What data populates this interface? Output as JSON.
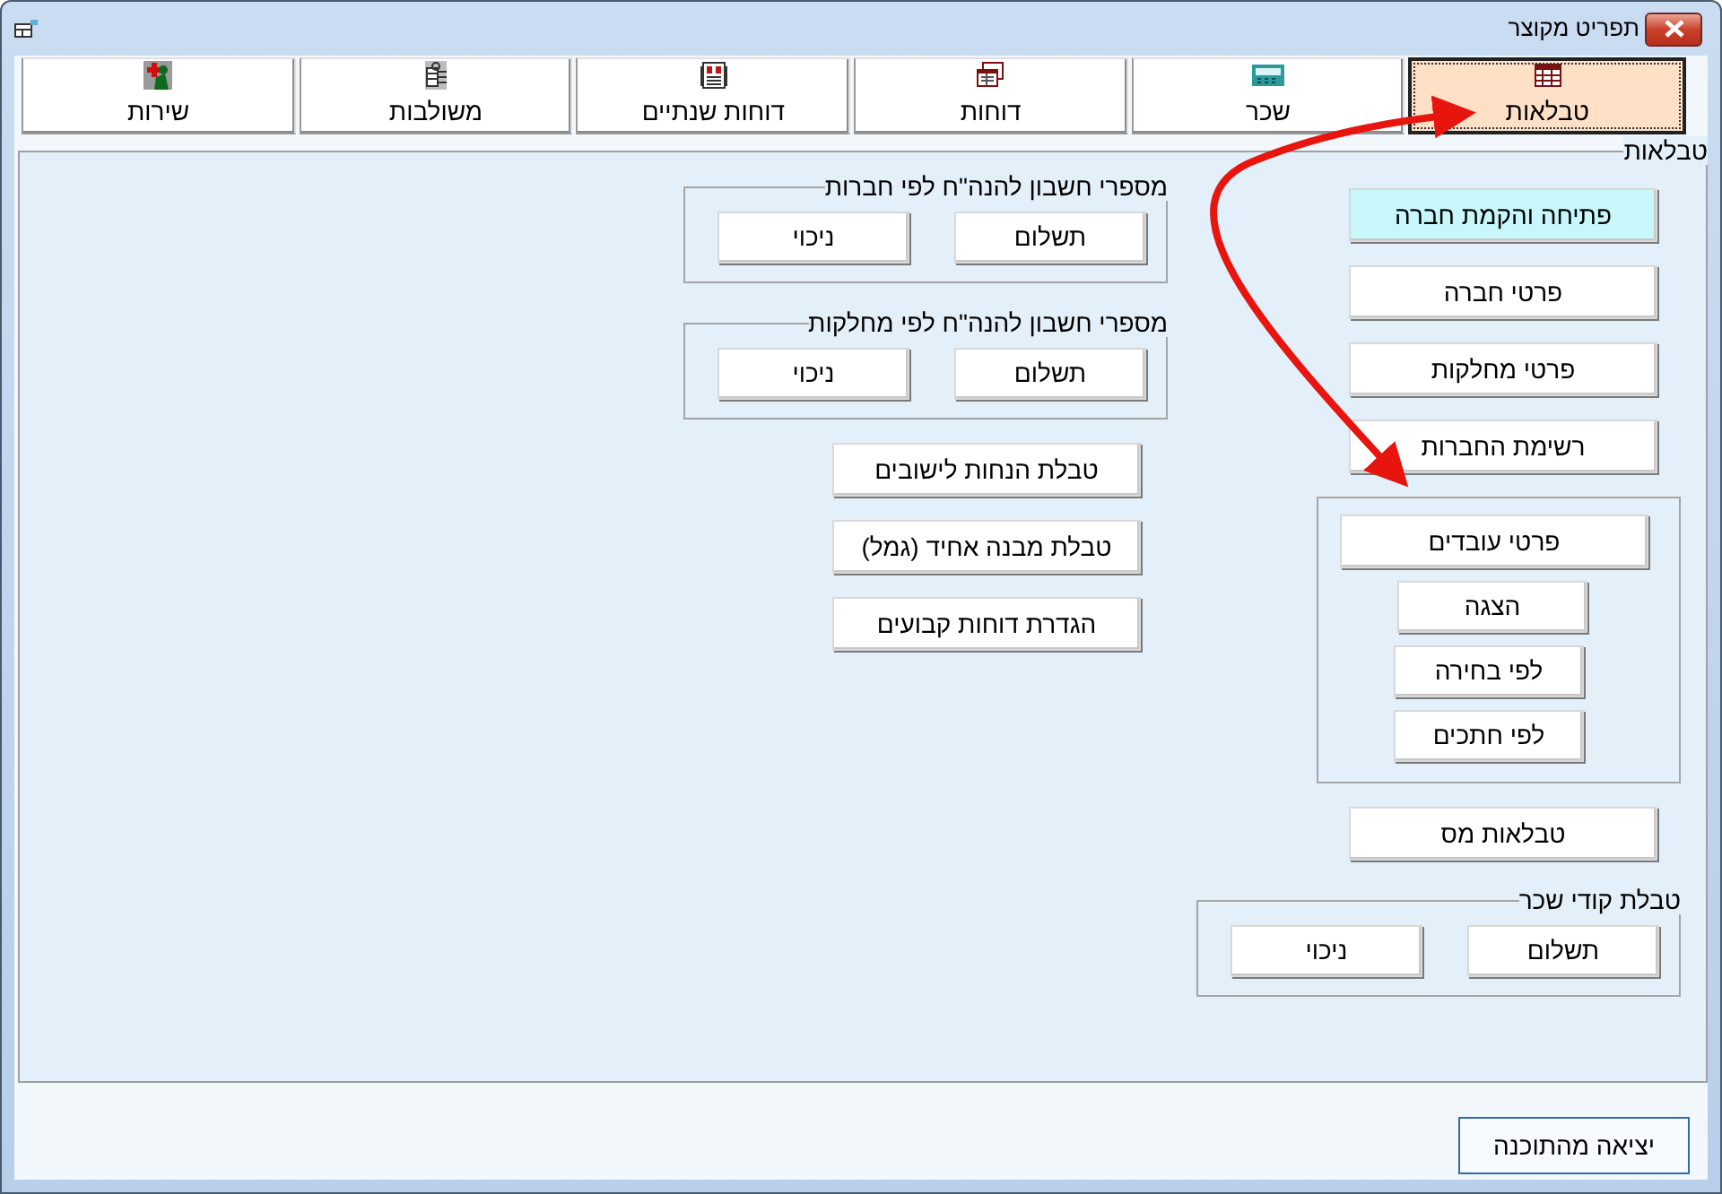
{
  "window": {
    "title": "תפריט מקוצר"
  },
  "tabs": [
    {
      "label": "טבלאות",
      "selected": true
    },
    {
      "label": "שכר",
      "selected": false
    },
    {
      "label": "דוחות",
      "selected": false
    },
    {
      "label": "דוחות שנתיים",
      "selected": false
    },
    {
      "label": "משולבות",
      "selected": false
    },
    {
      "label": "שירות",
      "selected": false
    }
  ],
  "section_label": "טבלאות",
  "right_column": [
    {
      "kind": "button",
      "label": "פתיחה והקמת חברה",
      "highlighted": true
    },
    {
      "kind": "button",
      "label": "פרטי חברה",
      "highlighted": false
    },
    {
      "kind": "button",
      "label": "פרטי מחלקות",
      "highlighted": false
    },
    {
      "kind": "button",
      "label": "רשימת החברות",
      "highlighted": false
    },
    {
      "kind": "stack",
      "buttons": [
        {
          "label": "פרטי עובדים"
        },
        {
          "label": "הצגה"
        },
        {
          "label": "לפי בחירה"
        },
        {
          "label": "לפי חתכים"
        }
      ]
    },
    {
      "kind": "button",
      "label": "טבלאות מס",
      "highlighted": false
    },
    {
      "kind": "pair",
      "title": "טבלת קודי שכר",
      "buttons": [
        {
          "label": "תשלום"
        },
        {
          "label": "ניכוי"
        }
      ]
    }
  ],
  "left_column": [
    {
      "kind": "pair",
      "title": "מספרי חשבון להנה\"ח לפי חברות",
      "buttons": [
        {
          "label": "תשלום"
        },
        {
          "label": "ניכוי"
        }
      ]
    },
    {
      "kind": "pair",
      "title": "מספרי חשבון להנה\"ח לפי מחלקות",
      "buttons": [
        {
          "label": "תשלום"
        },
        {
          "label": "ניכוי"
        }
      ]
    },
    {
      "kind": "button",
      "label": "טבלת הנחות לישובים",
      "highlighted": false
    },
    {
      "kind": "button",
      "label": "טבלת מבנה אחיד (גמל)",
      "highlighted": false
    },
    {
      "kind": "button",
      "label": "הגדרת דוחות קבועים",
      "highlighted": false
    }
  ],
  "exit_button": {
    "label": "יציאה מהתוכנה"
  }
}
